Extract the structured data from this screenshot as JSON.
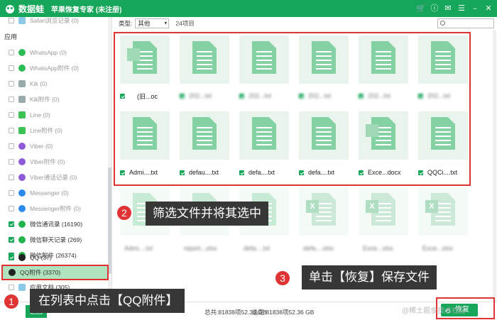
{
  "app": {
    "name": "数据蛙",
    "subtitle": "苹果恢复专家 (未注册)",
    "window_icons": [
      "cart-icon",
      "info-icon",
      "chat-icon",
      "menu-icon",
      "minimize-icon",
      "close-icon"
    ]
  },
  "sidebar": {
    "top_item": {
      "label": "Safari浏览记录 (0)",
      "checked": false
    },
    "section_title": "应用",
    "items": [
      {
        "label": "WhatsApp (0)",
        "icon": "whatsapp-icon",
        "checked": false
      },
      {
        "label": "WhatsApp附件 (0)",
        "icon": "whatsapp-icon",
        "checked": false
      },
      {
        "label": "Kik (0)",
        "icon": "kik-icon",
        "checked": false
      },
      {
        "label": "Kik附件 (0)",
        "icon": "kik-icon",
        "checked": false
      },
      {
        "label": "Line (0)",
        "icon": "line-icon",
        "checked": false
      },
      {
        "label": "Line附件 (0)",
        "icon": "line-icon",
        "checked": false
      },
      {
        "label": "Viber (0)",
        "icon": "viber-icon",
        "checked": false
      },
      {
        "label": "Viber附件 (0)",
        "icon": "viber-icon",
        "checked": false
      },
      {
        "label": "Viber通话记录 (0)",
        "icon": "viber-icon",
        "checked": false
      },
      {
        "label": "Messenger (0)",
        "icon": "messenger-icon",
        "checked": false
      },
      {
        "label": "Messenger附件 (0)",
        "icon": "messenger-icon",
        "checked": false
      },
      {
        "label": "微信通讯录 (16190)",
        "icon": "wechat-icon",
        "checked": true
      },
      {
        "label": "微信聊天记录 (269)",
        "icon": "wechat-icon",
        "checked": true
      },
      {
        "label": "微信附件 (26374)",
        "icon": "wechat-icon",
        "checked": true
      },
      {
        "label": "QQ (37)",
        "icon": "qq-icon",
        "checked": true
      },
      {
        "label": "QQ附件 (3370)",
        "icon": "qq-icon",
        "checked": false,
        "selected": true
      },
      {
        "label": "应用文档 (305)",
        "icon": "folder-icon",
        "checked": false
      }
    ]
  },
  "toolbar": {
    "type_label": "类型:",
    "type_value": "其他",
    "count_label": "24项目"
  },
  "grid": {
    "row1": [
      {
        "caption": "(旧...oc",
        "checked": true,
        "blur": false,
        "kind": "doc-stack"
      },
      {
        "caption": "202...txt",
        "checked": true,
        "blur": true,
        "kind": "doc"
      },
      {
        "caption": "202...txt",
        "checked": true,
        "blur": true,
        "kind": "doc"
      },
      {
        "caption": "202...txt",
        "checked": true,
        "blur": true,
        "kind": "doc"
      },
      {
        "caption": "202...txt",
        "checked": true,
        "blur": true,
        "kind": "doc"
      },
      {
        "caption": "202...txt",
        "checked": true,
        "blur": true,
        "kind": "doc"
      }
    ],
    "row2": [
      {
        "caption": "Admi....txt",
        "checked": true,
        "blur": false,
        "kind": "doc"
      },
      {
        "caption": "defau....txt",
        "checked": true,
        "blur": false,
        "kind": "doc"
      },
      {
        "caption": "defa....txt",
        "checked": true,
        "blur": false,
        "kind": "doc"
      },
      {
        "caption": "defa....txt",
        "checked": true,
        "blur": false,
        "kind": "doc"
      },
      {
        "caption": "Exce...docx",
        "checked": true,
        "blur": false,
        "kind": "doc-stack"
      },
      {
        "caption": "QQCi....txt",
        "checked": true,
        "blur": false,
        "kind": "doc"
      }
    ],
    "row3": [
      {
        "caption": "Admi....txt",
        "kind": "doc"
      },
      {
        "caption": "report...xlsx",
        "kind": "doc"
      },
      {
        "caption": "defa....txt",
        "kind": "doc"
      },
      {
        "caption": "defa....xlsx",
        "kind": "xls"
      },
      {
        "caption": "Exce...xlsx",
        "kind": "xls"
      },
      {
        "caption": "Exce...xlsx",
        "kind": "xls"
      }
    ]
  },
  "status": {
    "total": "总共:81838项52.36 GB",
    "selected": "选定:81838项52.36 GB",
    "back_label": "返回",
    "recover_label": "恢复"
  },
  "callouts": [
    {
      "number": "1",
      "text": "在列表中点击【QQ附件】"
    },
    {
      "number": "2",
      "text": "筛选文件并将其选中"
    },
    {
      "number": "3",
      "text": "单击【恢复】保存文件"
    }
  ],
  "watermark": "@稀土掘金技术社区",
  "colors": {
    "brand": "#16a65a",
    "highlight": "#e03434",
    "callout_bg": "#373737"
  }
}
